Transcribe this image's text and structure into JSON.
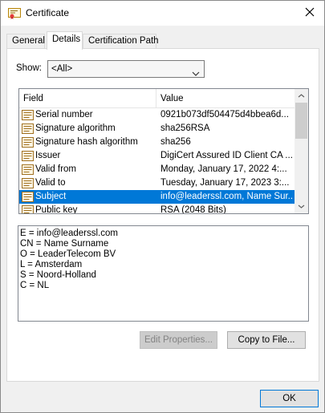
{
  "window": {
    "title": "Certificate"
  },
  "tabs": [
    {
      "label": "General"
    },
    {
      "label": "Details"
    },
    {
      "label": "Certification Path"
    }
  ],
  "show": {
    "label": "Show:",
    "selected": "<All>"
  },
  "list": {
    "columns": {
      "field": "Field",
      "value": "Value"
    },
    "rows": [
      {
        "field": "Serial number",
        "value": "0921b073df504475d4bbea6d..."
      },
      {
        "field": "Signature algorithm",
        "value": "sha256RSA"
      },
      {
        "field": "Signature hash algorithm",
        "value": "sha256"
      },
      {
        "field": "Issuer",
        "value": "DigiCert Assured ID Client CA ..."
      },
      {
        "field": "Valid from",
        "value": "Monday, January 17, 2022 4:..."
      },
      {
        "field": "Valid to",
        "value": "Tuesday, January 17, 2023 3:..."
      },
      {
        "field": "Subject",
        "value": "info@leaderssl.com, Name Sur..."
      },
      {
        "field": "Public key",
        "value": "RSA (2048 Bits)"
      }
    ],
    "selected_row": "Subject"
  },
  "details": {
    "lines": [
      "E = info@leaderssl.com",
      "CN = Name Surname",
      "O = LeaderTelecom BV",
      "L = Amsterdam",
      "S = Noord-Holland",
      "C = NL"
    ]
  },
  "buttons": {
    "edit_properties": "Edit Properties...",
    "copy_to_file": "Copy to File...",
    "ok": "OK"
  },
  "colors": {
    "selection": "#0078d7",
    "panel_bg": "#ffffff",
    "window_bg": "#f0f0f0"
  },
  "icons": {
    "title": "certificate-icon",
    "field": "certificate-field-icon",
    "close": "close-icon"
  }
}
